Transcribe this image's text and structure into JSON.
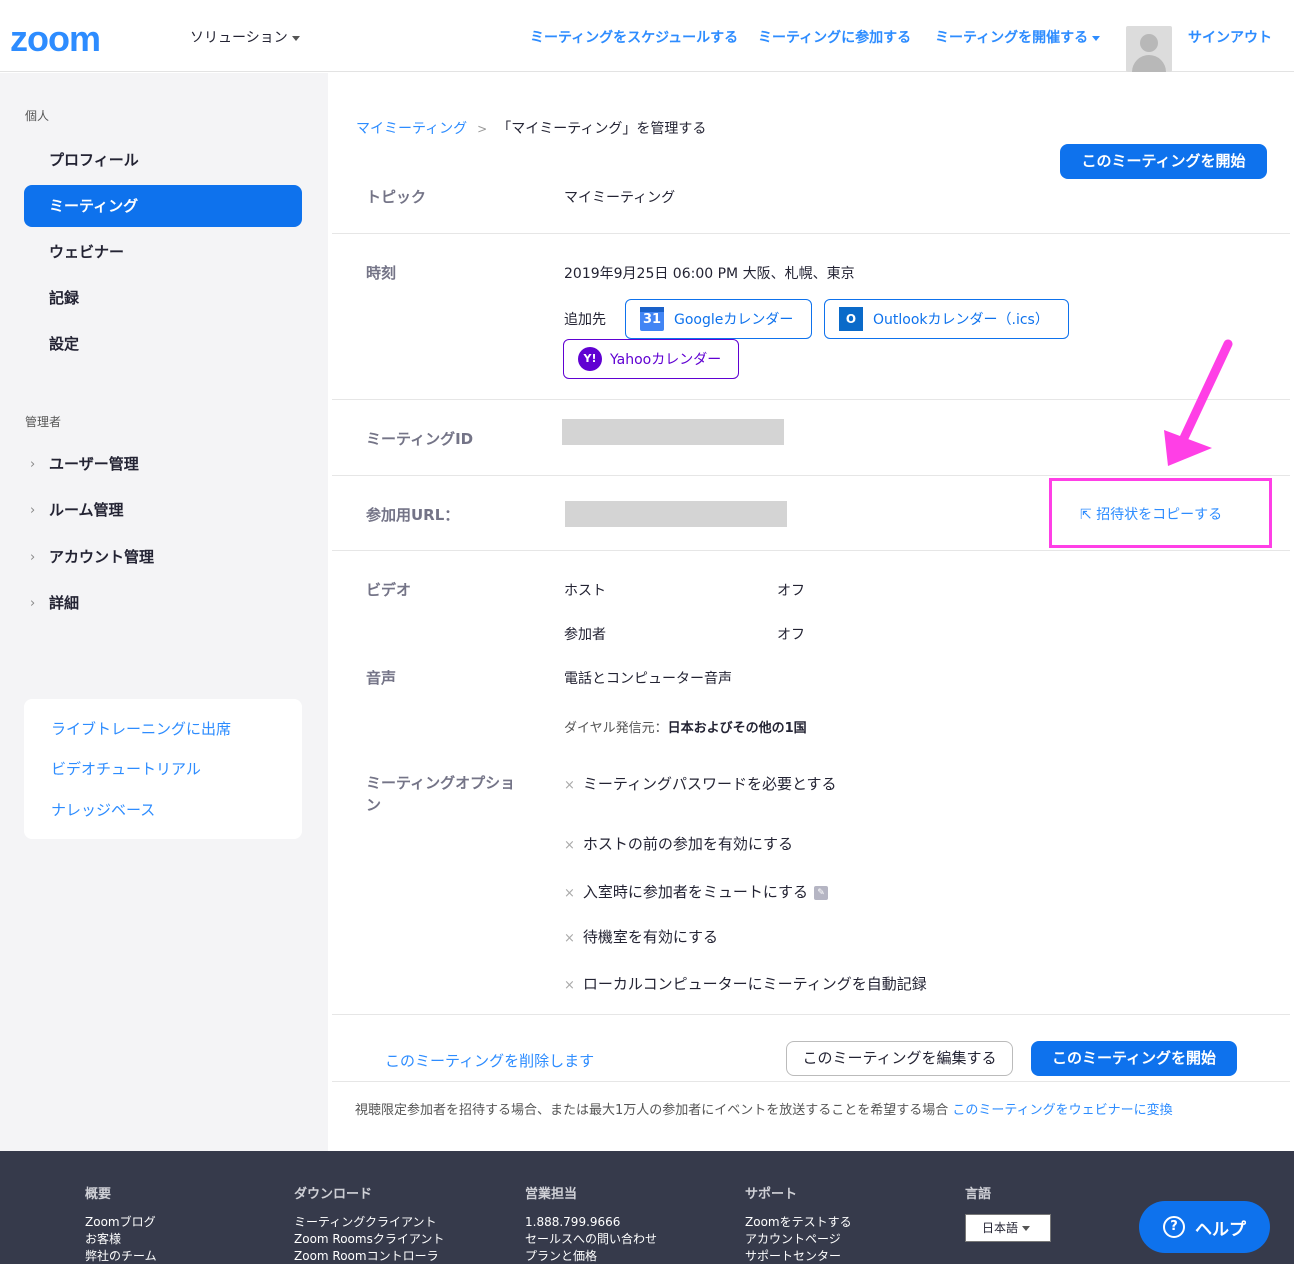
{
  "header": {
    "logo": "zoom",
    "solutions": "ソリューション",
    "nav": {
      "schedule": "ミーティングをスケジュールする",
      "join": "ミーティングに参加する",
      "host": "ミーティングを開催する",
      "signout": "サインアウト"
    }
  },
  "sidebar": {
    "personal_title": "個人",
    "personal_items": [
      "プロフィール",
      "ミーティング",
      "ウェビナー",
      "記録",
      "設定"
    ],
    "admin_title": "管理者",
    "admin_items": [
      "ユーザー管理",
      "ルーム管理",
      "アカウント管理",
      "詳細"
    ],
    "help_links": [
      "ライブトレーニングに出席",
      "ビデオチュートリアル",
      "ナレッジベース"
    ]
  },
  "main": {
    "breadcrumb_link": "マイミーティング",
    "breadcrumb_sep": ">",
    "breadcrumb_current": "「マイミーティング」を管理する",
    "start_button": "このミーティングを開始",
    "topic_label": "トピック",
    "topic_value": "マイミーティング",
    "time_label": "時刻",
    "time_value": "2019年9月25日 06:00 PM 大阪、札幌、東京",
    "add_to_label": "追加先",
    "calendars": {
      "google": "Googleカレンダー",
      "google_icon": "31",
      "outlook": "Outlookカレンダー（.ics）",
      "outlook_icon": "O",
      "yahoo": "Yahooカレンダー",
      "yahoo_icon": "Y!"
    },
    "meeting_id_label": "ミーティングID",
    "join_url_label": "参加用URL：",
    "copy_invitation": "招待状をコピーする",
    "video_label": "ビデオ",
    "video_host_label": "ホスト",
    "video_host_value": "オフ",
    "video_participant_label": "参加者",
    "video_participant_value": "オフ",
    "audio_label": "音声",
    "audio_value": "電話とコンピューター音声",
    "dial_from_label": "ダイヤル発信元：",
    "dial_from_value": "日本およびその他の1国",
    "options_label": "ミーティングオプション",
    "options": [
      "ミーティングパスワードを必要とする",
      "ホストの前の参加を有効にする",
      "入室時に参加者をミュートにする",
      "待機室を有効にする",
      "ローカルコンピューターにミーティングを自動記録"
    ],
    "delete_link": "このミーティングを削除します",
    "edit_button": "このミーティングを編集する",
    "start_button_bottom": "このミーティングを開始",
    "webinar_note": "視聴限定参加者を招待する場合、または最大1万人の参加者にイベントを放送することを希望する場合",
    "webinar_link": "このミーティングをウェビナーに変換"
  },
  "footer": {
    "columns": [
      {
        "title": "概要",
        "items": [
          "Zoomブログ",
          "お客様",
          "弊社のチーム"
        ]
      },
      {
        "title": "ダウンロード",
        "items": [
          "ミーティングクライアント",
          "Zoom Roomsクライアント",
          "Zoom Roomコントローラ"
        ]
      },
      {
        "title": "営業担当",
        "items": [
          "1.888.799.9666",
          "セールスへの問い合わせ",
          "プランと価格"
        ]
      },
      {
        "title": "サポート",
        "items": [
          "Zoomをテストする",
          "アカウントページ",
          "サポートセンター"
        ]
      }
    ],
    "language_title": "言語",
    "language_value": "日本語",
    "help_button": "ヘルプ",
    "help_icon": "?"
  },
  "colors": {
    "brand_blue": "#0e72ed",
    "link_blue": "#2d8cff",
    "annotation_magenta": "#ff3fe6",
    "footer_bg": "#363a4b"
  }
}
